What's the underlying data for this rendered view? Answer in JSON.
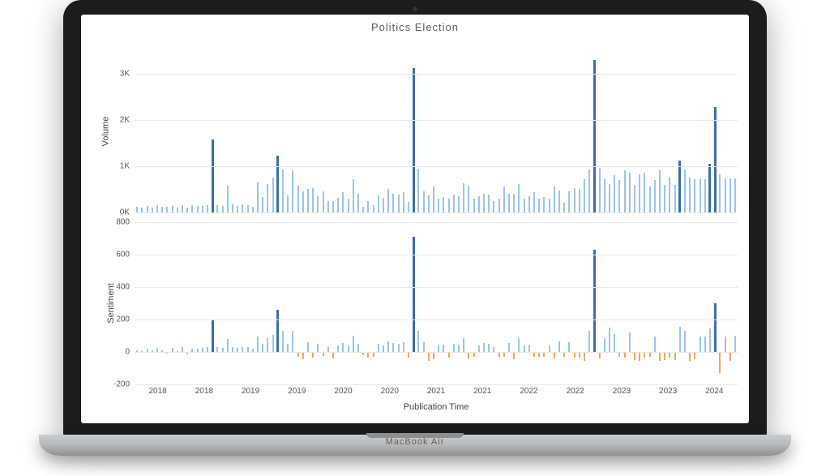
{
  "device": {
    "brand": "MacBook Air"
  },
  "chart_data": [
    {
      "type": "bar",
      "title": "Politics Election",
      "xlabel": "",
      "ylabel": "Volume",
      "ylim": [
        0,
        3500
      ],
      "yticks": [
        0,
        1000,
        2000,
        3000
      ],
      "ytick_labels": [
        "0K",
        "1K",
        "2K",
        "3K"
      ],
      "x_major_labels": [
        "2018",
        "2018",
        "2019",
        "2019",
        "2020",
        "2020",
        "2021",
        "2021",
        "2022",
        "2022",
        "2023",
        "2023",
        "2024"
      ],
      "xlim": [
        0,
        312
      ],
      "values": [
        120,
        105,
        140,
        110,
        150,
        130,
        120,
        145,
        100,
        160,
        110,
        150,
        135,
        140,
        150,
        1580,
        160,
        140,
        570,
        180,
        145,
        170,
        160,
        130,
        640,
        340,
        610,
        750,
        1230,
        930,
        370,
        910,
        570,
        460,
        510,
        520,
        350,
        460,
        250,
        240,
        320,
        440,
        300,
        710,
        400,
        130,
        250,
        150,
        370,
        320,
        500,
        400,
        380,
        440,
        230,
        3120,
        950,
        460,
        370,
        560,
        300,
        340,
        300,
        380,
        350,
        630,
        580,
        300,
        350,
        400,
        380,
        250,
        300,
        560,
        400,
        400,
        610,
        300,
        350,
        440,
        300,
        330,
        300,
        560,
        480,
        210,
        460,
        520,
        500,
        720,
        930,
        3290,
        960,
        710,
        610,
        800,
        700,
        910,
        850,
        600,
        830,
        850,
        560,
        700,
        910,
        600,
        760,
        600,
        1120,
        930,
        760,
        710,
        710,
        710,
        1050,
        2280,
        830,
        730,
        730,
        730
      ]
    },
    {
      "type": "bar",
      "title": "",
      "xlabel": "Publication Time",
      "ylabel": "Sentiment",
      "ylim": [
        -200,
        800
      ],
      "yticks": [
        -200,
        0,
        200,
        400,
        600,
        800
      ],
      "ytick_labels": [
        "-200",
        "0",
        "200",
        "400",
        "600",
        "800"
      ],
      "x_major_labels": [
        "2018",
        "2018",
        "2019",
        "2019",
        "2020",
        "2020",
        "2021",
        "2021",
        "2022",
        "2022",
        "2023",
        "2023",
        "2024"
      ],
      "xlim": [
        0,
        312
      ],
      "values": [
        10,
        5,
        20,
        10,
        25,
        10,
        -10,
        25,
        5,
        30,
        -15,
        20,
        20,
        25,
        30,
        195,
        30,
        25,
        80,
        30,
        25,
        30,
        30,
        20,
        95,
        50,
        85,
        105,
        260,
        130,
        50,
        130,
        -30,
        -45,
        60,
        -35,
        50,
        -25,
        30,
        -40,
        40,
        55,
        40,
        100,
        50,
        -20,
        -35,
        -30,
        50,
        40,
        65,
        55,
        50,
        60,
        -35,
        710,
        130,
        60,
        -55,
        -45,
        40,
        45,
        -35,
        50,
        45,
        85,
        -40,
        -30,
        40,
        55,
        50,
        30,
        -30,
        -30,
        55,
        -45,
        85,
        40,
        45,
        -30,
        -30,
        -30,
        40,
        -40,
        65,
        -30,
        60,
        -35,
        -35,
        -55,
        130,
        630,
        -40,
        85,
        150,
        110,
        -30,
        -35,
        120,
        -50,
        -55,
        -35,
        -30,
        95,
        -55,
        -50,
        -35,
        -50,
        155,
        130,
        -55,
        -45,
        95,
        95,
        145,
        300,
        -130,
        95,
        -55,
        100
      ]
    }
  ]
}
